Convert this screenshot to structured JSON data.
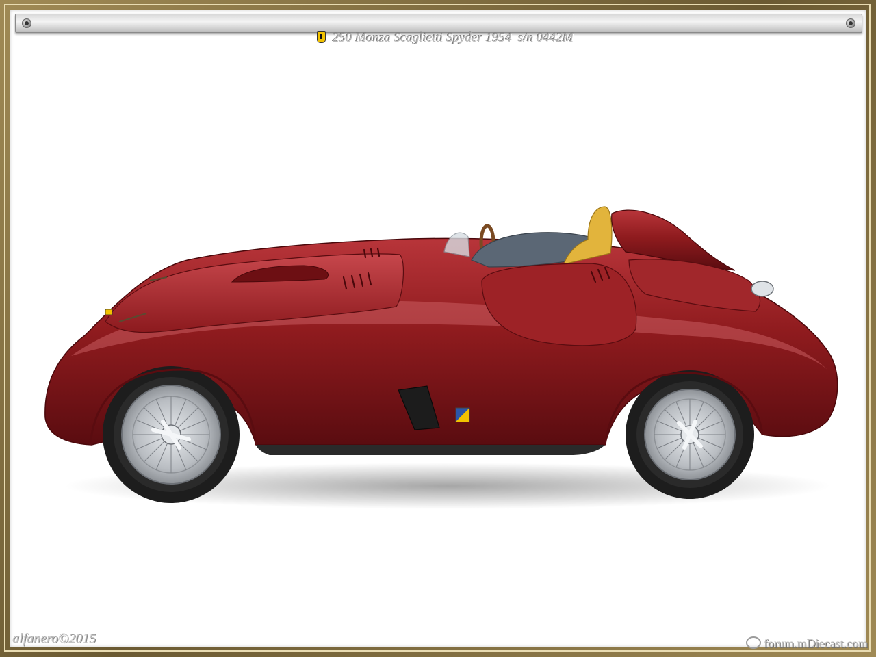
{
  "header": {
    "title": "250 Monza Scaglietti Spyder 1954  s/n 0442M",
    "logo_icon": "prancing-horse-badge-icon"
  },
  "photo": {
    "subject": "",
    "colors": {
      "body": "#8f1b1e",
      "seat": "#e2b43c",
      "wheel": "#c9ccd0",
      "tire": "#1d1d1d"
    }
  },
  "footer": {
    "credit": "alfanero©2015",
    "site": "forum.mDiecast.com"
  }
}
